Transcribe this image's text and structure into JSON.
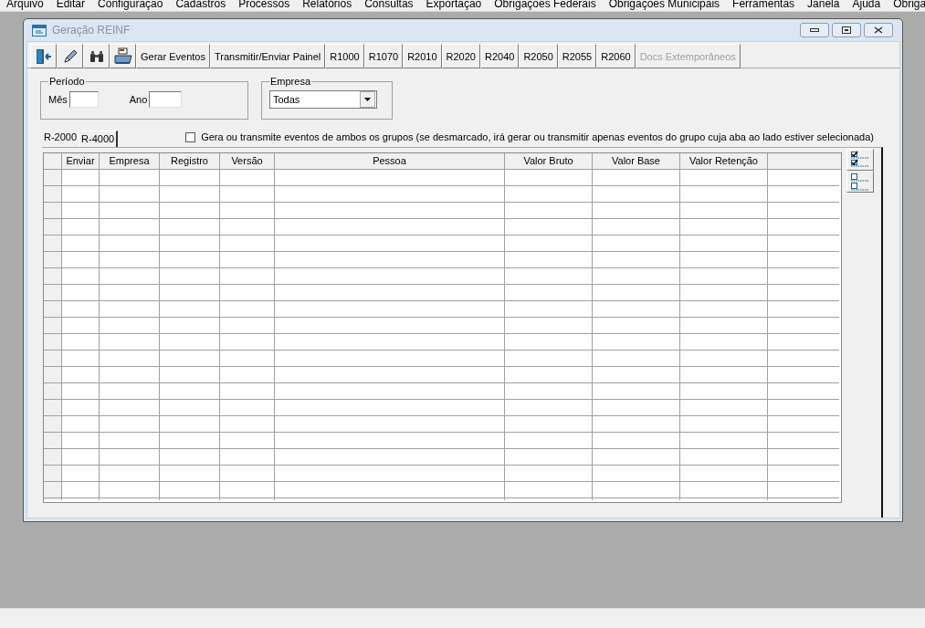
{
  "menu_bar": [
    "Arquivo",
    "Editar",
    "Configuração",
    "Cadastros",
    "Processos",
    "Relatórios",
    "Consultas",
    "Exportação",
    "Obrigações Federais",
    "Obrigações Municipais",
    "Ferramentas",
    "Janela",
    "Ajuda",
    "Obriga"
  ],
  "window": {
    "title": "Geração REINF"
  },
  "toolbar": [
    {
      "kind": "icon"
    },
    {
      "kind": "icon"
    },
    {
      "kind": "icon"
    },
    {
      "kind": "icon"
    },
    {
      "kind": "text",
      "label": "Gerar Eventos",
      "disabled": false
    },
    {
      "kind": "text",
      "label": "Transmitir/Enviar Painel",
      "disabled": false
    },
    {
      "kind": "text",
      "label": "R1000",
      "disabled": false
    },
    {
      "kind": "text",
      "label": "R1070",
      "disabled": false
    },
    {
      "kind": "text",
      "label": "R2010",
      "disabled": false
    },
    {
      "kind": "text",
      "label": "R2020",
      "disabled": false
    },
    {
      "kind": "text",
      "label": "R2040",
      "disabled": false
    },
    {
      "kind": "text",
      "label": "R2050",
      "disabled": false
    },
    {
      "kind": "text",
      "label": "R2055",
      "disabled": false
    },
    {
      "kind": "text",
      "label": "R2060",
      "disabled": false
    },
    {
      "kind": "text",
      "label": "Docs Extemporâneos",
      "disabled": true
    }
  ],
  "periodo": {
    "title": "Período",
    "mes_label": "Mês",
    "ano_label": "Ano"
  },
  "empresa": {
    "title": "Empresa",
    "value": "Todas"
  },
  "tabs": [
    {
      "label": "R-2000",
      "selected": true
    },
    {
      "label": "R-4000",
      "selected": false
    }
  ],
  "ambos": {
    "label": "Gera ou transmite eventos de ambos os grupos (se desmarcado, irá gerar ou transmitir apenas eventos do grupo cuja aba ao lado estiver selecionada)",
    "checked": false
  },
  "table": {
    "columns": [
      "Enviar",
      "Empresa",
      "Registro",
      "Versão",
      "Pessoa",
      "Valor Bruto",
      "Valor Base",
      "Valor Retenção"
    ]
  }
}
